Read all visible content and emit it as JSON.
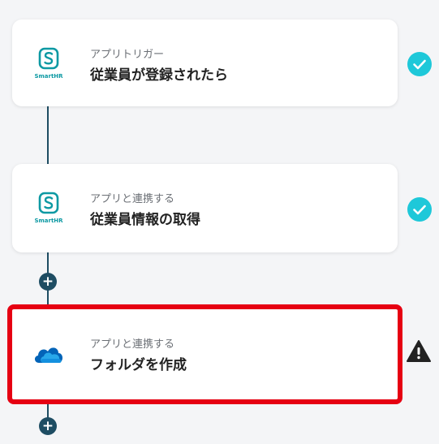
{
  "flow": {
    "steps": [
      {
        "app": "SmartHR",
        "logo_icon": "smarthr-logo-icon",
        "subtitle": "アプリトリガー",
        "title": "従業員が登録されたら",
        "status": "check",
        "status_color": "#1ec8d9"
      },
      {
        "app": "SmartHR",
        "logo_icon": "smarthr-logo-icon",
        "subtitle": "アプリと連携する",
        "title": "従業員情報の取得",
        "status": "check",
        "status_color": "#1ec8d9"
      },
      {
        "app": "OneDrive",
        "logo_icon": "onedrive-logo-icon",
        "subtitle": "アプリと連携する",
        "title": "フォルダを作成",
        "status": "warning",
        "status_color": "#222222",
        "selected": true,
        "selection_color": "#e60012"
      }
    ],
    "add_button_label": "+"
  },
  "colors": {
    "connector": "#1e4d63",
    "smarthr": "#0d99a3"
  }
}
